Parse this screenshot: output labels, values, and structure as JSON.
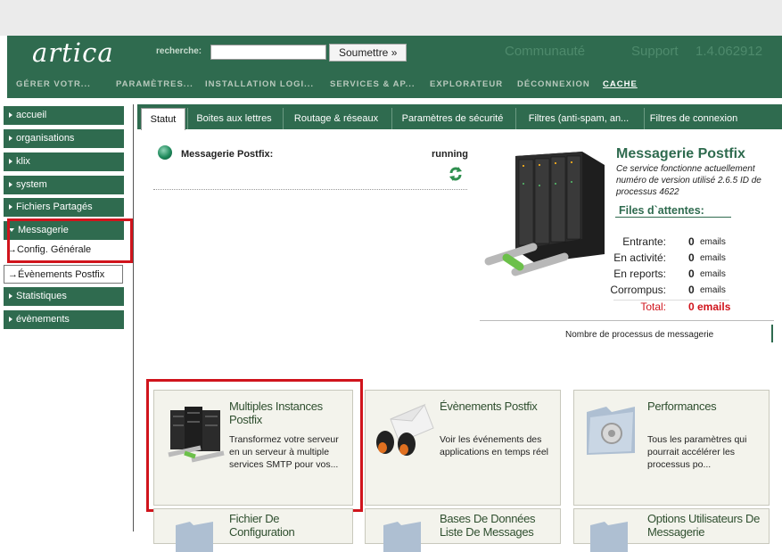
{
  "header": {
    "logo": "artica",
    "search_label": "recherche:",
    "search_value": "",
    "submit_label": "Soumettre »",
    "links": [
      "Communauté",
      "Support",
      "1.4.062912"
    ]
  },
  "menu": [
    "GÉRER VOTR...",
    "PARAMÈTRES...",
    "INSTALLATION LOGI...",
    "SERVICES & AP...",
    "EXPLORATEUR",
    "DÉCONNEXION",
    "CACHE"
  ],
  "sidebar": {
    "items": [
      "accueil",
      "organisations",
      "klix",
      "system",
      "Fichiers Partagés"
    ],
    "messagerie": "Messagerie",
    "config": "Config. Générale",
    "evenements_postfix": "Évènements Postfix",
    "statistiques": "Statistiques",
    "evenements": "évènements"
  },
  "tabs": [
    "Statut",
    "Boites aux lettres",
    "Routage & réseaux",
    "Paramètres de sécurité",
    "Filtres (anti-spam, an...",
    "Filtres de connexion"
  ],
  "service": {
    "name": "Messagerie Postfix:",
    "status": "running"
  },
  "postfix": {
    "title": "Messagerie Postfix",
    "desc": "Ce service fonctionne actuellement numéro de version utilisé 2.6.5 ID de processus 4622",
    "queue_title": "Files d`attentes:",
    "queues": [
      {
        "label": "Entrante:",
        "value": "0",
        "unit": "emails"
      },
      {
        "label": "En activité:",
        "value": "0",
        "unit": "emails"
      },
      {
        "label": "En reports:",
        "value": "0",
        "unit": "emails"
      },
      {
        "label": "Corrompus:",
        "value": "0",
        "unit": "emails"
      }
    ],
    "total_label": "Total:",
    "total_value": "0 emails",
    "processes_label": "Nombre de processus de messagerie"
  },
  "cards": [
    {
      "title": "Multiples Instances Postfix",
      "desc": "Transformez votre serveur en un serveur à multiple services SMTP pour vos..."
    },
    {
      "title": "Évènements Postfix",
      "desc": "Voir les événements des applications en temps réel"
    },
    {
      "title": "Performances",
      "desc": "Tous les paramètres qui pourrait accélérer les processus po..."
    },
    {
      "title": "Fichier De Configuration",
      "desc": ""
    },
    {
      "title": "Bases De Données Liste De Messages",
      "desc": ""
    },
    {
      "title": "Options Utilisateurs De Messagerie",
      "desc": ""
    }
  ],
  "colors": {
    "accent": "#2f6b4f",
    "highlight": "#d0141c"
  }
}
